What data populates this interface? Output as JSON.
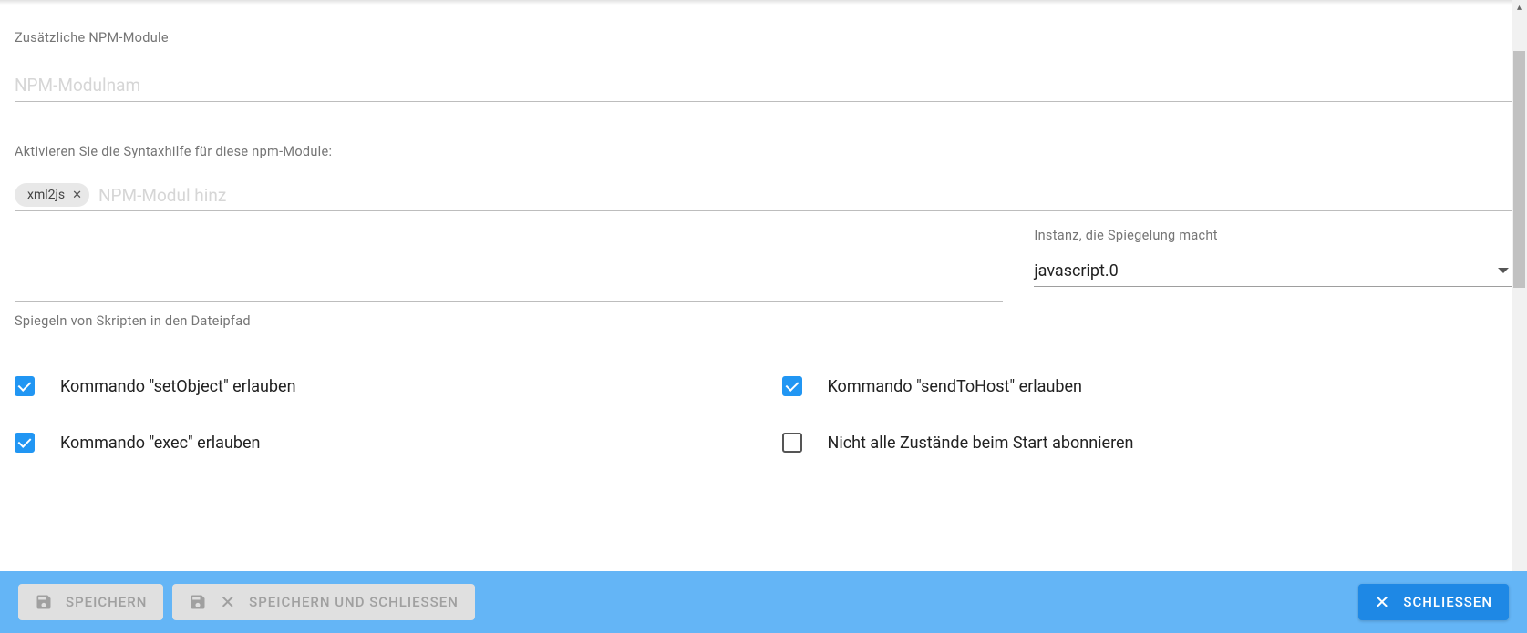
{
  "labels": {
    "additional_npm": "Zusätzliche NPM-Module",
    "syntax_help": "Aktivieren Sie die Syntaxhilfe für diese npm-Module:",
    "mirror_hint": "Spiegeln von Skripten in den Dateipfad",
    "instance_label": "Instanz, die Spiegelung macht"
  },
  "inputs": {
    "npm_module_placeholder": "NPM-Modulnam",
    "chip_input_placeholder": "NPM-Modul hinz",
    "mirror_path_value": ""
  },
  "chips": [
    {
      "label": "xml2js"
    }
  ],
  "select": {
    "instance_value": "javascript.0"
  },
  "checkboxes": {
    "set_object": {
      "label": "Kommando \"setObject\" erlauben",
      "checked": true
    },
    "send_to_host": {
      "label": "Kommando \"sendToHost\" erlauben",
      "checked": true
    },
    "exec": {
      "label": "Kommando \"exec\" erlauben",
      "checked": true
    },
    "not_all_states": {
      "label": "Nicht alle Zustände beim Start abonnieren",
      "checked": false
    }
  },
  "buttons": {
    "save": "SPEICHERN",
    "save_close": "SPEICHERN UND SCHLIESSEN",
    "close": "SCHLIESSEN"
  }
}
